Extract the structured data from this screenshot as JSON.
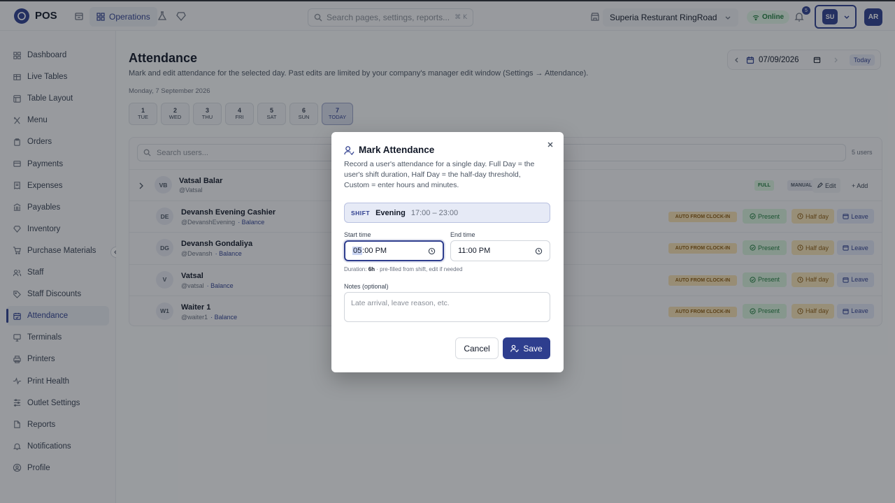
{
  "app": {
    "brand": "POS"
  },
  "topbar": {
    "ops_label": "Operations",
    "search_placeholder": "Search pages, settings, reports...",
    "search_shortcut": "⌘ K",
    "store_name": "Superia Resturant RingRoad",
    "status": "Online",
    "notifications_count": "5",
    "user_switch_initials": "SU",
    "avatar_initials": "AR"
  },
  "sidebar": {
    "items": [
      {
        "label": "Dashboard",
        "icon": "grid-icon"
      },
      {
        "label": "Live Tables",
        "icon": "table-icon"
      },
      {
        "label": "Table Layout",
        "icon": "layout-icon"
      },
      {
        "label": "Menu",
        "icon": "utensils-icon"
      },
      {
        "label": "Orders",
        "icon": "clipboard-icon"
      },
      {
        "label": "Payments",
        "icon": "credit-card-icon"
      },
      {
        "label": "Expenses",
        "icon": "receipt-icon"
      },
      {
        "label": "Payables",
        "icon": "bank-icon"
      },
      {
        "label": "Inventory",
        "icon": "boxes-icon"
      },
      {
        "label": "Purchase Materials",
        "icon": "cart-icon"
      },
      {
        "label": "Staff",
        "icon": "users-icon"
      },
      {
        "label": "Staff Discounts",
        "icon": "tag-icon"
      },
      {
        "label": "Attendance",
        "icon": "calendar-check-icon"
      },
      {
        "label": "Terminals",
        "icon": "monitor-icon"
      },
      {
        "label": "Printers",
        "icon": "printer-icon"
      },
      {
        "label": "Print Health",
        "icon": "activity-icon"
      },
      {
        "label": "Outlet Settings",
        "icon": "sliders-icon"
      },
      {
        "label": "Reports",
        "icon": "file-icon"
      },
      {
        "label": "Notifications",
        "icon": "bell-icon"
      },
      {
        "label": "Profile",
        "icon": "user-circle-icon"
      }
    ],
    "active": "Attendance"
  },
  "page": {
    "title": "Attendance",
    "subtitle": "Mark and edit attendance for the selected day. Past edits are limited by your company's manager edit window (Settings → Attendance).",
    "date_label": "Monday, 7 September 2026",
    "date_value": "07/09/2026",
    "today_label": "Today",
    "days": [
      {
        "num": "1",
        "dow": "TUE"
      },
      {
        "num": "2",
        "dow": "WED"
      },
      {
        "num": "3",
        "dow": "THU"
      },
      {
        "num": "4",
        "dow": "FRI"
      },
      {
        "num": "5",
        "dow": "SAT"
      },
      {
        "num": "6",
        "dow": "SUN"
      },
      {
        "num": "7",
        "dow": "TODAY"
      }
    ]
  },
  "users_panel": {
    "search_placeholder": "Search users...",
    "count": "5 users",
    "expanded_user": {
      "initials": "VB",
      "name": "Vatsal Balar",
      "handle": "@Vatsal",
      "chip_full": "FULL",
      "chip_manual": "MANUAL",
      "edit_label": "Edit",
      "add_label": "+ Add"
    },
    "rows": [
      {
        "initials": "DE",
        "name": "Devansh Evening Cashier",
        "handle": "@DevanshEvening",
        "balance": "· Balance"
      },
      {
        "initials": "DG",
        "name": "Devansh Gondaliya",
        "handle": "@Devansh",
        "balance": "· Balance"
      },
      {
        "initials": "V",
        "name": "Vatsal",
        "handle": "@vatsal",
        "balance": "· Balance"
      },
      {
        "initials": "W1",
        "name": "Waiter 1",
        "handle": "@waiter1",
        "balance": "· Balance"
      }
    ],
    "row_chip": "AUTO FROM CLOCK-IN",
    "present_label": "Present",
    "half_label": "Half day",
    "leave_label": "Leave"
  },
  "modal": {
    "title": "Mark Attendance",
    "description": "Record a user's attendance for a single day. Full Day = the user's shift duration, Half Day = the half-day threshold, Custom = enter hours and minutes.",
    "shift_tag": "SHIFT",
    "shift_name": "Evening",
    "shift_time": "17:00 – 23:00",
    "start_label": "Start time",
    "start_hour": "05",
    "start_rest": ":00 PM",
    "end_label": "End time",
    "end_value": "11:00 PM",
    "duration_prefix": "Duration:",
    "duration_value": "6h",
    "duration_suffix": "· pre-filled from shift, edit if needed",
    "notes_label": "Notes (optional)",
    "notes_placeholder": "Late arrival, leave reason, etc.",
    "cancel_label": "Cancel",
    "save_label": "Save"
  },
  "colors": {
    "accent": "#2e3e8e",
    "success": "#1e7a3c",
    "warning": "#8a5a10"
  }
}
